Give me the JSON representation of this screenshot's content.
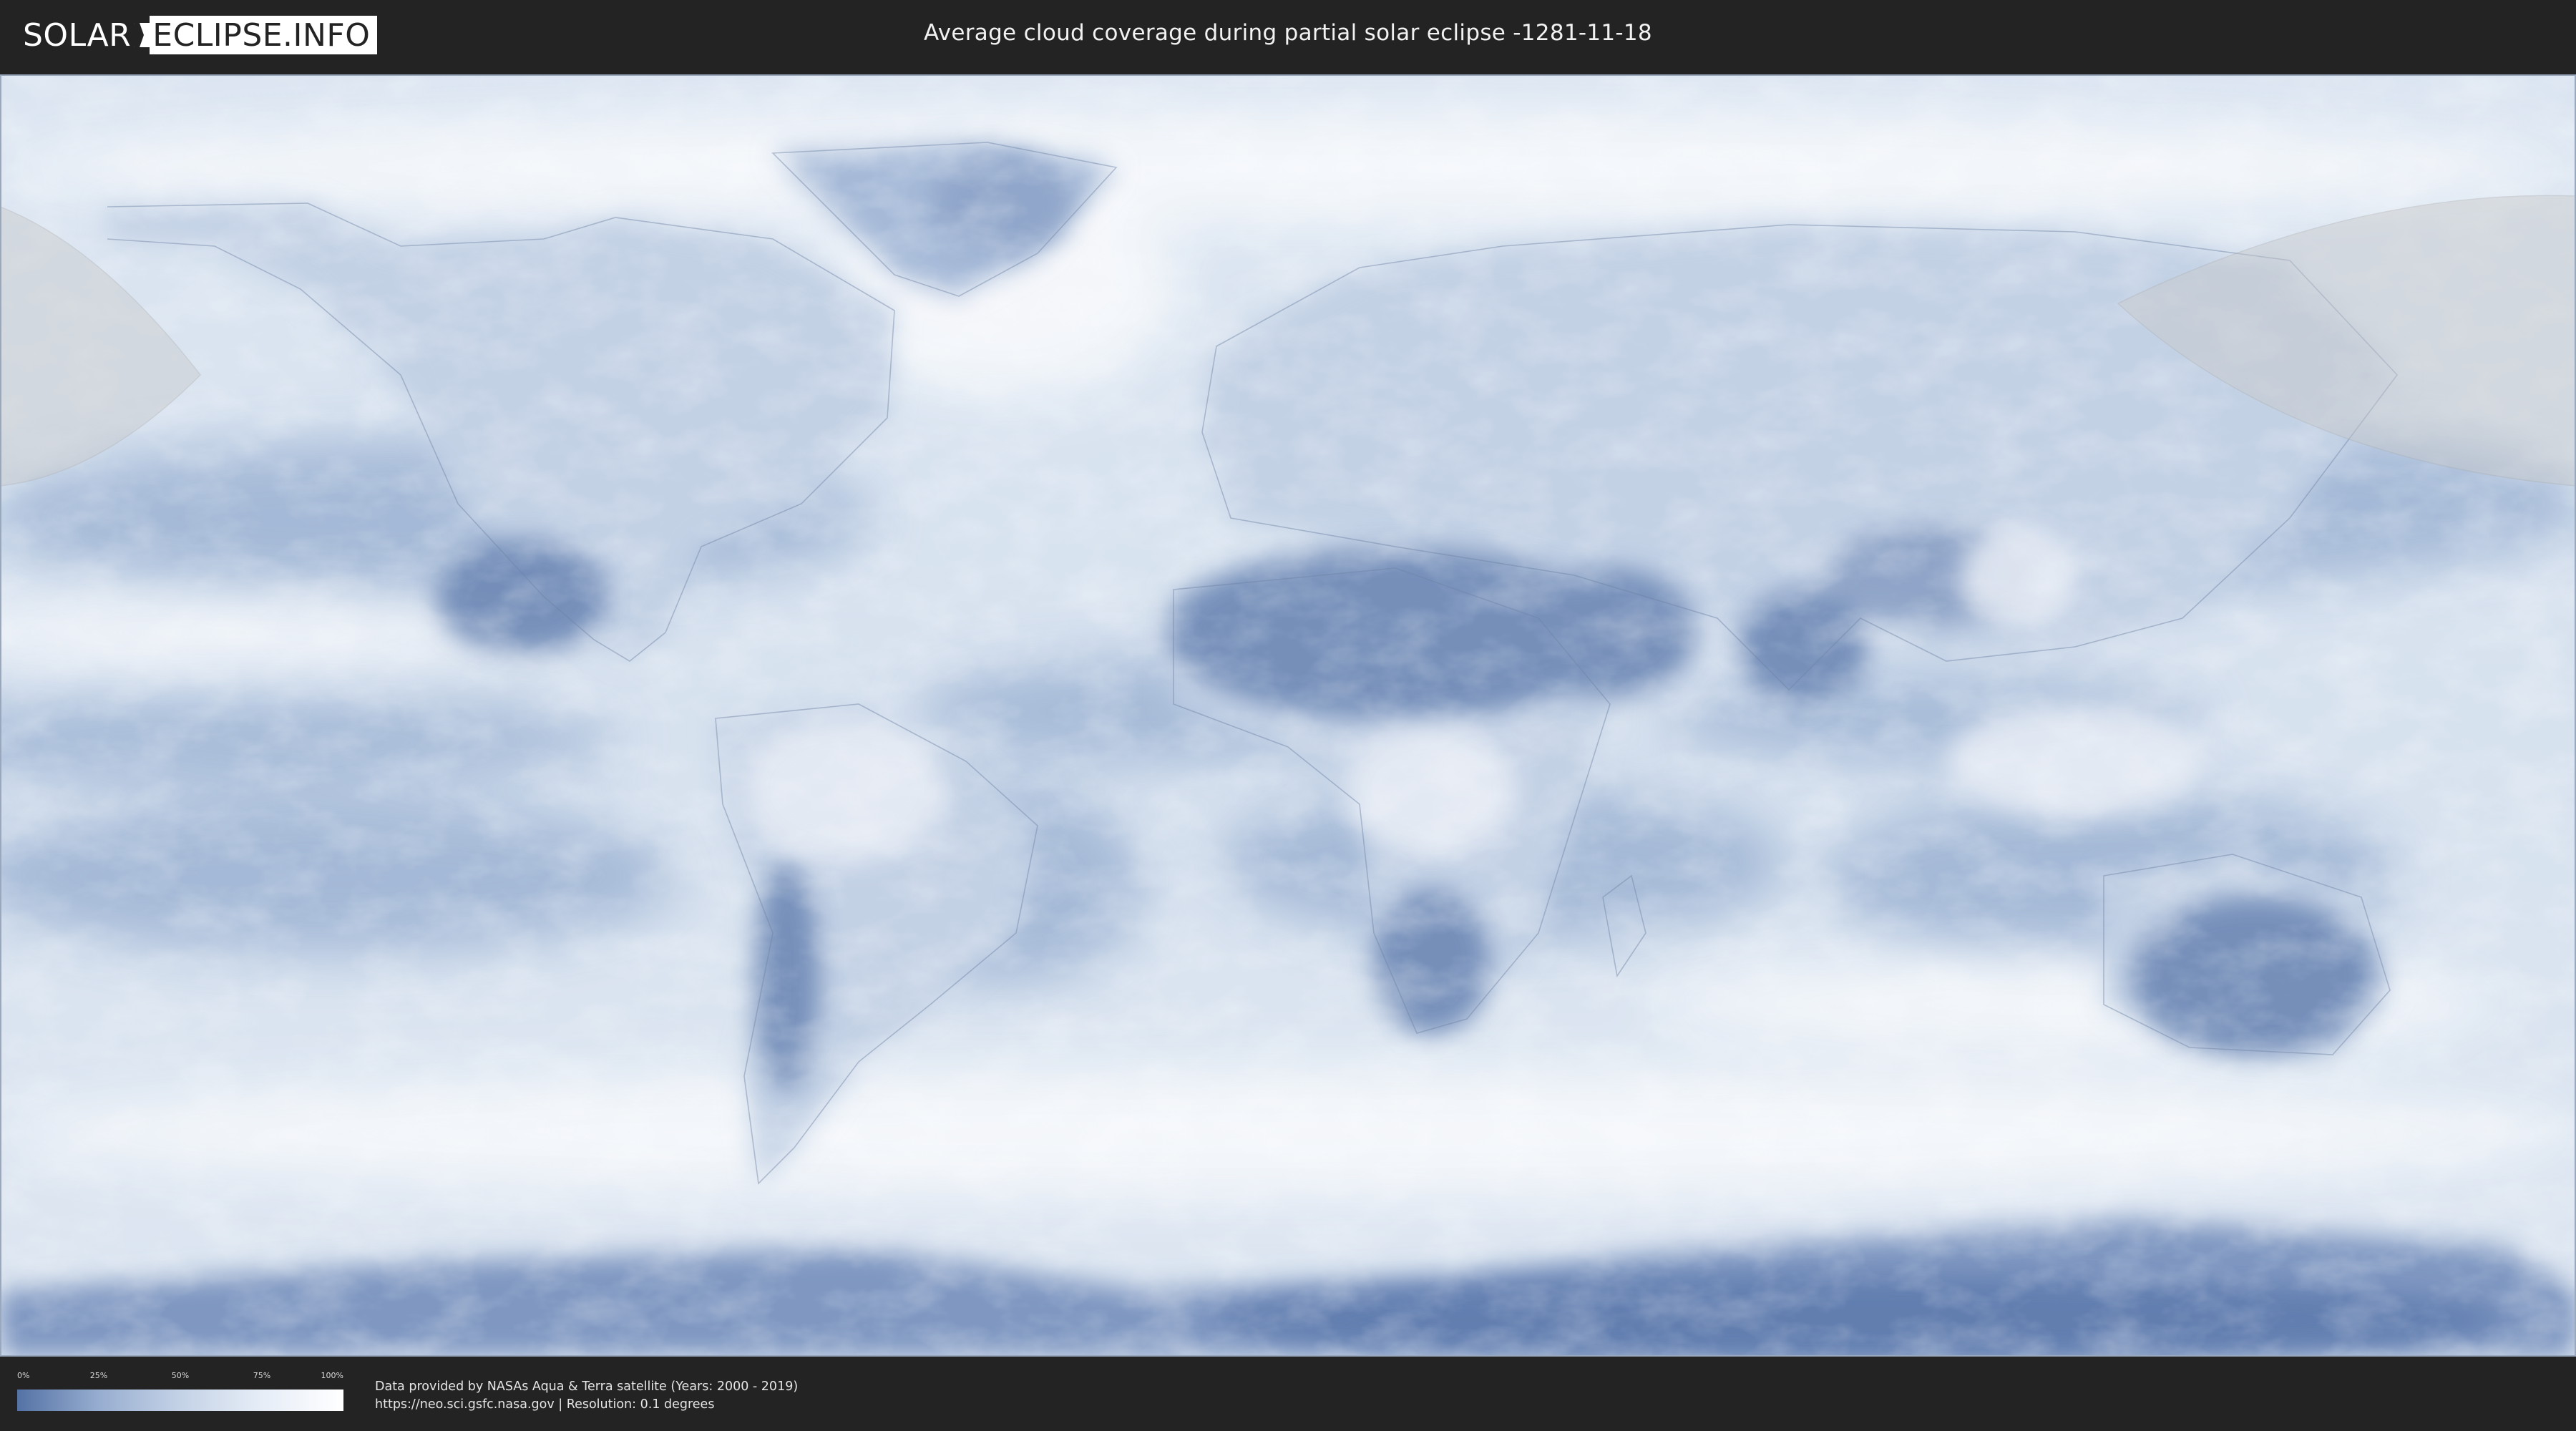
{
  "header": {
    "logo": {
      "left": "SOLAR",
      "right": "ECLIPSE.INFO"
    },
    "title": "Average cloud coverage during partial solar eclipse -1281-11-18"
  },
  "map": {
    "legend": {
      "ticks": [
        "0%",
        "25%",
        "50%",
        "75%",
        "100%"
      ],
      "colors": {
        "low": "#5472a5",
        "high": "#ffffff"
      }
    }
  },
  "footer": {
    "credit_line1": "Data provided by NASAs Aqua & Terra satellite (Years: 2000 - 2019)",
    "credit_line2": "https://neo.sci.gsfc.nasa.gov | Resolution: 0.1 degrees"
  }
}
